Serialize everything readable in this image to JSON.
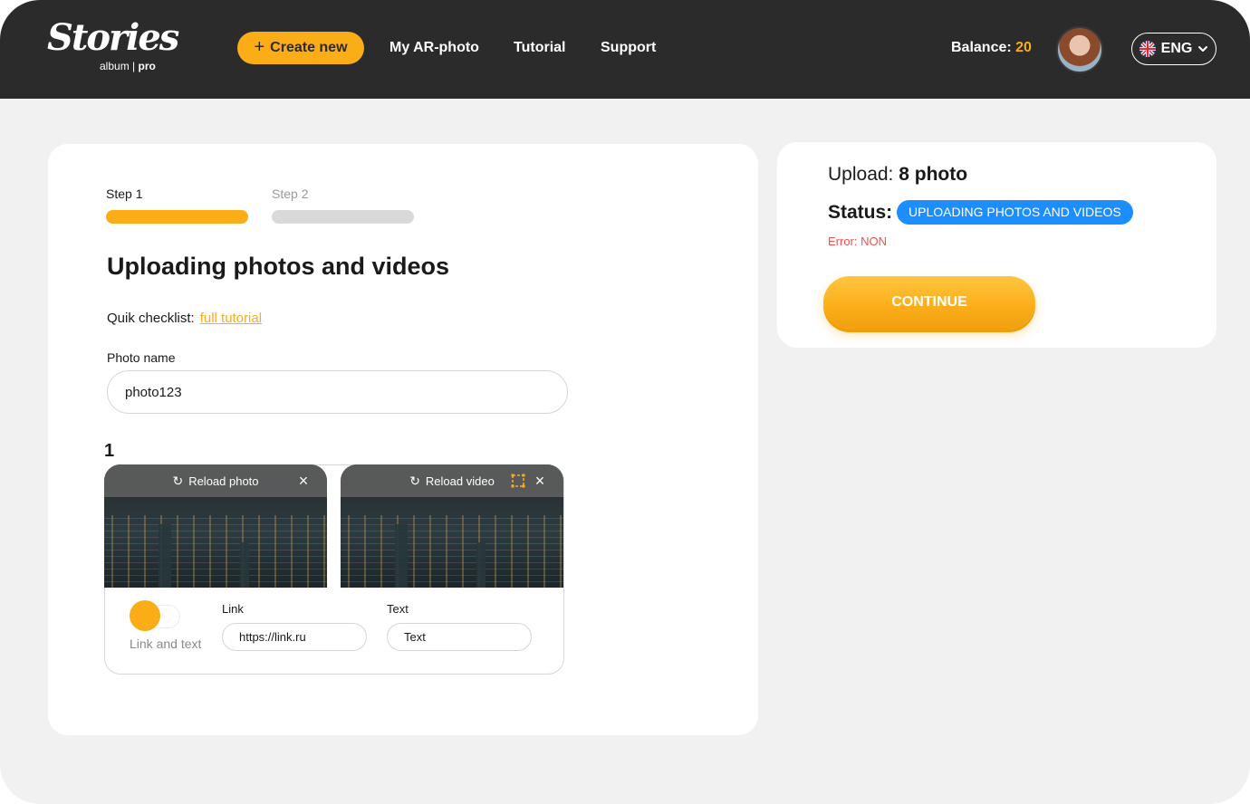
{
  "header": {
    "logo_script": "Stories",
    "logo_sub_album": "album",
    "logo_sub_pro": "pro",
    "create_label": "Create new",
    "nav": [
      "My AR-photo",
      "Tutorial",
      "Support"
    ],
    "balance_label": "Balance:",
    "balance_value": "20",
    "language": "ENG"
  },
  "steps": [
    {
      "label": "Step 1",
      "active": true
    },
    {
      "label": "Step 2",
      "active": false
    }
  ],
  "main": {
    "title": "Uploading photos and videos",
    "checklist_label": "Quik checklist:",
    "checklist_link": "full tutorial",
    "photo_name_label": "Photo name",
    "photo_name_value": "photo123",
    "item_number": "1",
    "photo_card": {
      "action": "Reload photo"
    },
    "video_card": {
      "action": "Reload video"
    },
    "toggle_label": "Link and text",
    "link_label": "Link",
    "link_value": "https://link.ru",
    "text_label": "Text",
    "text_value": "Text"
  },
  "side": {
    "upload_label": "Upload:",
    "upload_value": "8 photo",
    "status_label": "Status:",
    "status_value": "UPLOADING PHOTOS AND VIDEOS",
    "error_text": "Error: NON",
    "continue_label": "CONTINUE"
  },
  "colors": {
    "accent": "#fbad18",
    "header_bg": "#2b2b2b",
    "status_blue": "#1c8eff",
    "error_red": "#f05050",
    "inactive_step": "#d9d9d9"
  },
  "icons": [
    "plus-icon",
    "chevron-down-icon",
    "uk-flag-icon",
    "reload-icon",
    "close-icon",
    "crop-icon"
  ]
}
